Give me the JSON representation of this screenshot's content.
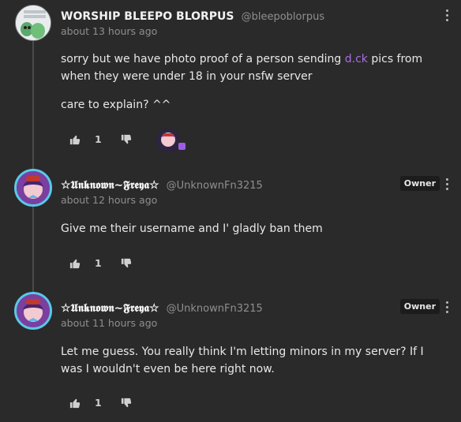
{
  "comments": [
    {
      "author": "WORSHIP BLEEPO BLORPUS",
      "handle": "@bleepoblorpus",
      "time": "about 13 hours ago",
      "text_parts": [
        "sorry but we have photo proof of a person sending ",
        "d.ck",
        " pics from when they were under 18 in your nsfw server"
      ],
      "text2": "care to explain? ^^",
      "likes": "1",
      "avatar_text": [
        "operator",
        "transgender",
        "aliens"
      ]
    },
    {
      "author": "☆𝖀𝖓𝖐𝖓𝖔𝖜𝖓~𝕱𝖗𝖊𝖞𝖆☆",
      "handle": "@UnknownFn3215",
      "time": "about 12 hours ago",
      "badge": "Owner",
      "text": "Give me their username and I' gladly ban them",
      "likes": "1"
    },
    {
      "author": "☆𝖀𝖓𝖐𝖓𝖔𝖜𝖓~𝕱𝖗𝖊𝖞𝖆☆",
      "handle": "@UnknownFn3215",
      "time": "about 11 hours ago",
      "badge": "Owner",
      "text": "Let me guess. You really think I'm letting minors in my server? If I was I wouldn't even be here right now.",
      "likes": "1"
    }
  ],
  "colors": {
    "background": "#2a2a2a",
    "link": "#a96ee0",
    "avatar_ring": "#58c9e8"
  },
  "icons": [
    "thumbs-up-icon",
    "thumbs-down-icon",
    "kebab-menu-icon"
  ]
}
